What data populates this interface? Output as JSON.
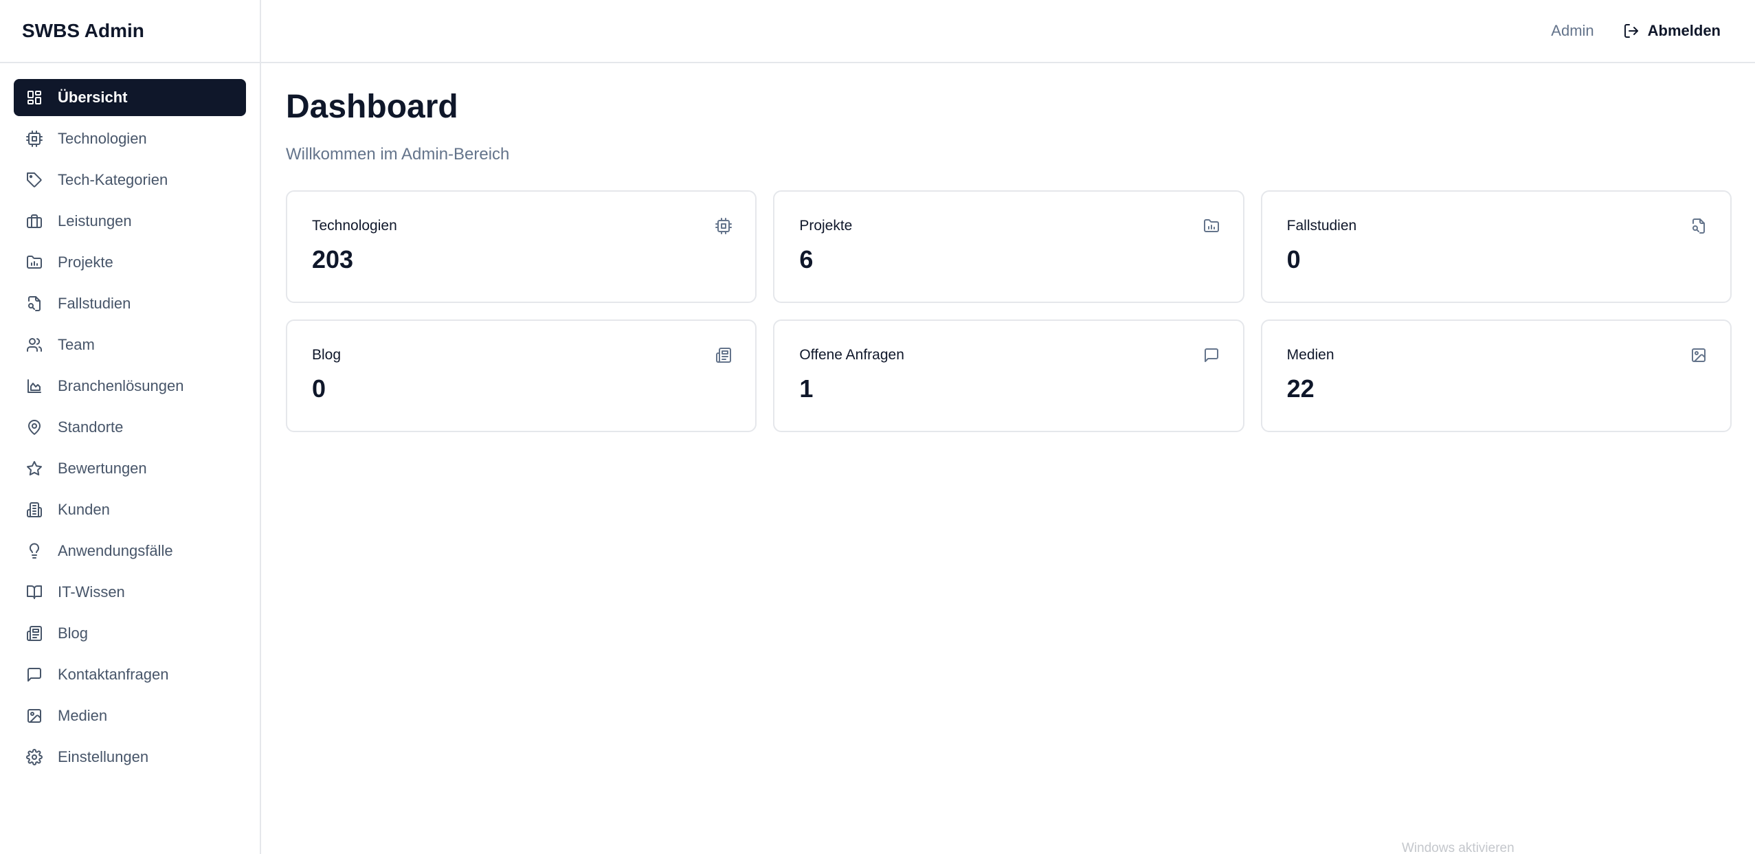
{
  "app": {
    "title": "SWBS Admin"
  },
  "header": {
    "user": "Admin",
    "logout_label": "Abmelden"
  },
  "sidebar": {
    "items": [
      {
        "label": "Übersicht",
        "icon": "layout-grid-icon",
        "active": true
      },
      {
        "label": "Technologien",
        "icon": "cpu-icon"
      },
      {
        "label": "Tech-Kategorien",
        "icon": "tag-icon"
      },
      {
        "label": "Leistungen",
        "icon": "briefcase-icon"
      },
      {
        "label": "Projekte",
        "icon": "folder-chart-icon"
      },
      {
        "label": "Fallstudien",
        "icon": "file-search-icon"
      },
      {
        "label": "Team",
        "icon": "users-icon"
      },
      {
        "label": "Branchenlösungen",
        "icon": "chart-area-icon"
      },
      {
        "label": "Standorte",
        "icon": "map-pin-icon"
      },
      {
        "label": "Bewertungen",
        "icon": "star-icon"
      },
      {
        "label": "Kunden",
        "icon": "building-icon"
      },
      {
        "label": "Anwendungsfälle",
        "icon": "lightbulb-icon"
      },
      {
        "label": "IT-Wissen",
        "icon": "book-open-icon"
      },
      {
        "label": "Blog",
        "icon": "newspaper-icon"
      },
      {
        "label": "Kontaktanfragen",
        "icon": "message-square-icon"
      },
      {
        "label": "Medien",
        "icon": "image-icon"
      },
      {
        "label": "Einstellungen",
        "icon": "settings-icon"
      }
    ]
  },
  "main": {
    "title": "Dashboard",
    "subtitle": "Willkommen im Admin-Bereich",
    "cards": [
      {
        "label": "Technologien",
        "value": "203",
        "icon": "cpu-icon"
      },
      {
        "label": "Projekte",
        "value": "6",
        "icon": "folder-chart-icon"
      },
      {
        "label": "Fallstudien",
        "value": "0",
        "icon": "file-search-icon"
      },
      {
        "label": "Blog",
        "value": "0",
        "icon": "newspaper-icon"
      },
      {
        "label": "Offene Anfragen",
        "value": "1",
        "icon": "message-square-icon"
      },
      {
        "label": "Medien",
        "value": "22",
        "icon": "image-icon"
      }
    ]
  },
  "os": {
    "watermark": "Windows aktivieren"
  },
  "colors": {
    "accent": "#0f172a",
    "muted": "#64748b",
    "border": "#e5e7eb"
  }
}
